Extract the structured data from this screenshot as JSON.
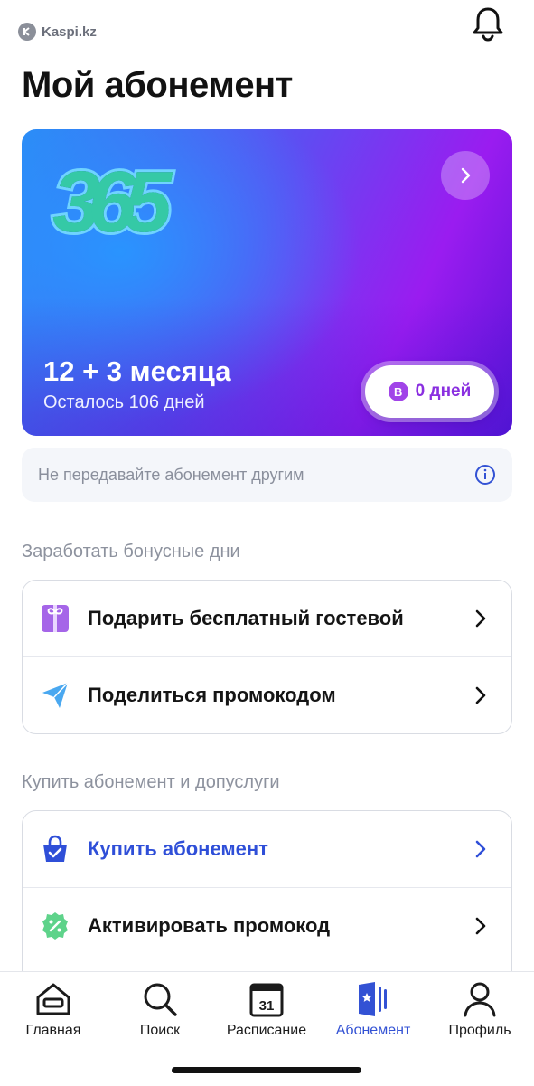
{
  "status_bar": {
    "carrier": "Kaspi.kz"
  },
  "header": {
    "title": "Мой абонемент"
  },
  "membership_card": {
    "logo_text": "365",
    "plan_name": "12 + 3 месяца",
    "remaining": "Осталось 106 дней",
    "bonus_badge_letter": "B",
    "bonus_days": "0 дней",
    "colors": {
      "gradient_start": "#2b8cf5",
      "gradient_end": "#9a1cf0"
    }
  },
  "notice": {
    "text": "Не передавайте абонемент другим"
  },
  "earn_section": {
    "title": "Заработать бонусные дни",
    "items": [
      {
        "label": "Подарить бесплатный гостевой",
        "icon": "gift-icon"
      },
      {
        "label": "Поделиться промокодом",
        "icon": "send-icon"
      }
    ]
  },
  "buy_section": {
    "title": "Купить абонемент и допуслуги",
    "items": [
      {
        "label": "Купить абонемент",
        "icon": "shopping-bag-icon"
      },
      {
        "label": "Активировать промокод",
        "icon": "percent-badge-icon"
      }
    ]
  },
  "bottom_nav": {
    "items": [
      {
        "label": "Главная",
        "icon": "home-icon"
      },
      {
        "label": "Поиск",
        "icon": "search-icon"
      },
      {
        "label": "Расписание",
        "icon": "calendar-icon",
        "calendar_day": "31"
      },
      {
        "label": "Абонемент",
        "icon": "membership-card-icon",
        "active": true
      },
      {
        "label": "Профиль",
        "icon": "profile-icon"
      }
    ],
    "active_color": "#3352d4"
  }
}
